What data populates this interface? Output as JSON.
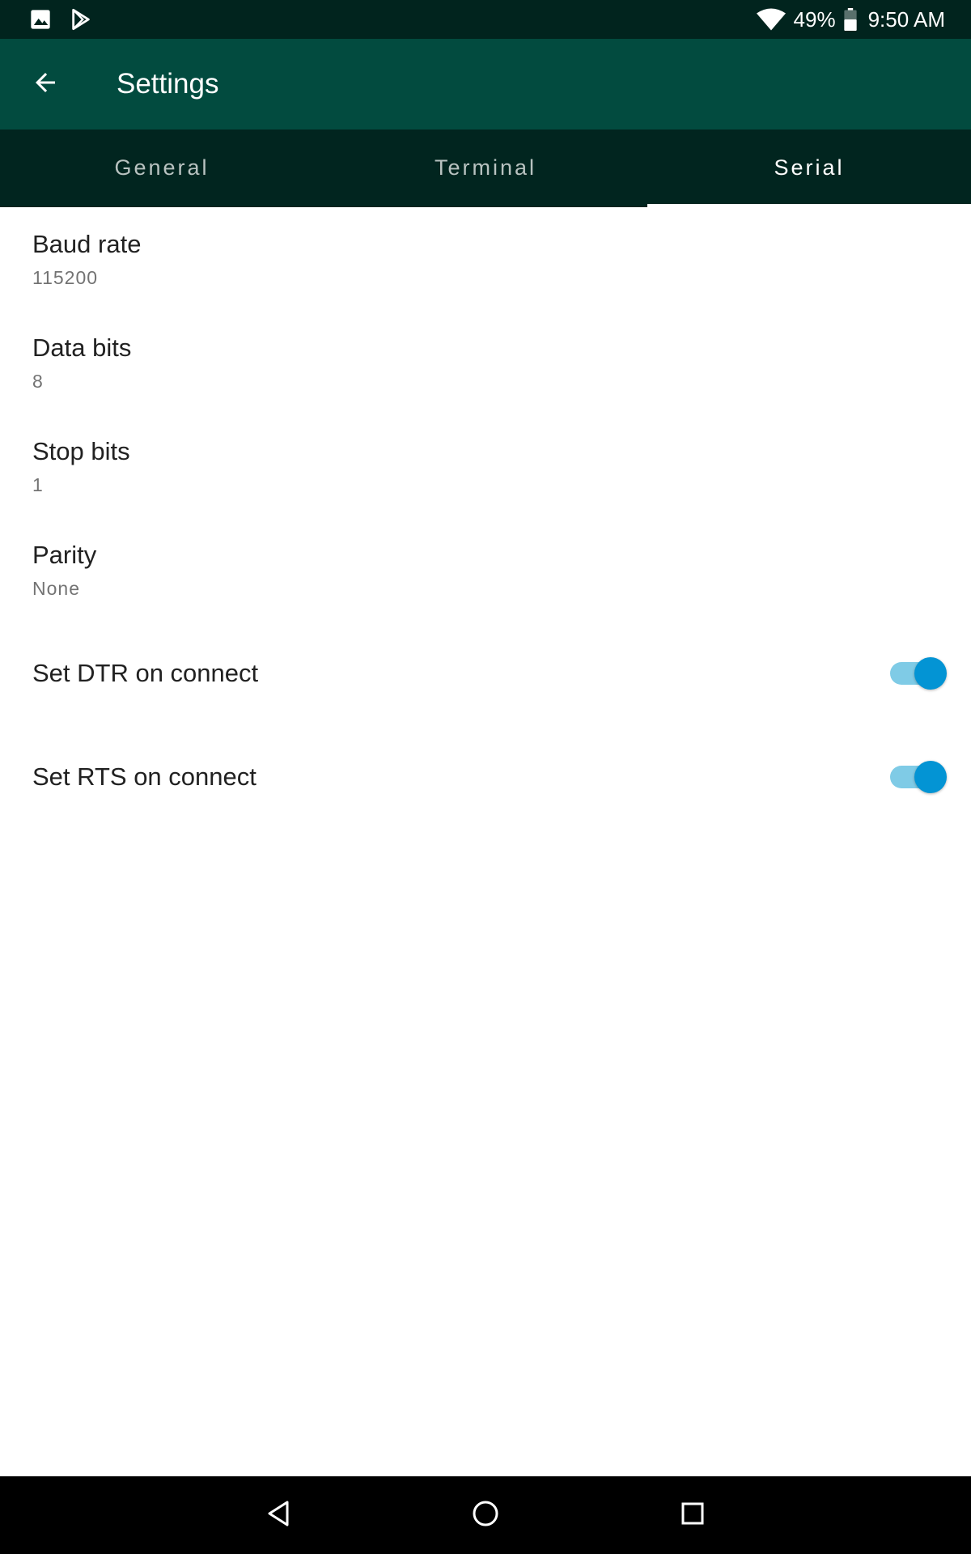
{
  "status_bar": {
    "icons_left": [
      "image-icon",
      "play-store-icon"
    ],
    "icons_right": [
      "wifi-icon",
      "battery-icon"
    ],
    "battery_percent": "49%",
    "time": "9:50 AM"
  },
  "app_bar": {
    "title": "Settings",
    "back_icon": "arrow-left-icon"
  },
  "tabs": [
    {
      "label": "General",
      "active": false
    },
    {
      "label": "Terminal",
      "active": false
    },
    {
      "label": "Serial",
      "active": true
    }
  ],
  "preferences": [
    {
      "title": "Baud rate",
      "summary": "115200"
    },
    {
      "title": "Data bits",
      "summary": "8"
    },
    {
      "title": "Stop bits",
      "summary": "1"
    },
    {
      "title": "Parity",
      "summary": "None"
    }
  ],
  "switches": [
    {
      "title": "Set DTR on connect",
      "checked": true
    },
    {
      "title": "Set RTS on connect",
      "checked": true
    }
  ],
  "nav_bar": {
    "buttons": [
      "back-triangle-icon",
      "home-circle-icon",
      "recents-square-icon"
    ]
  },
  "colors": {
    "status_bar": "#01241e",
    "app_bar": "#024b3f",
    "tab_bar": "#01251f",
    "switch_thumb": "#0394d4",
    "switch_track": "#7fcbe6"
  }
}
